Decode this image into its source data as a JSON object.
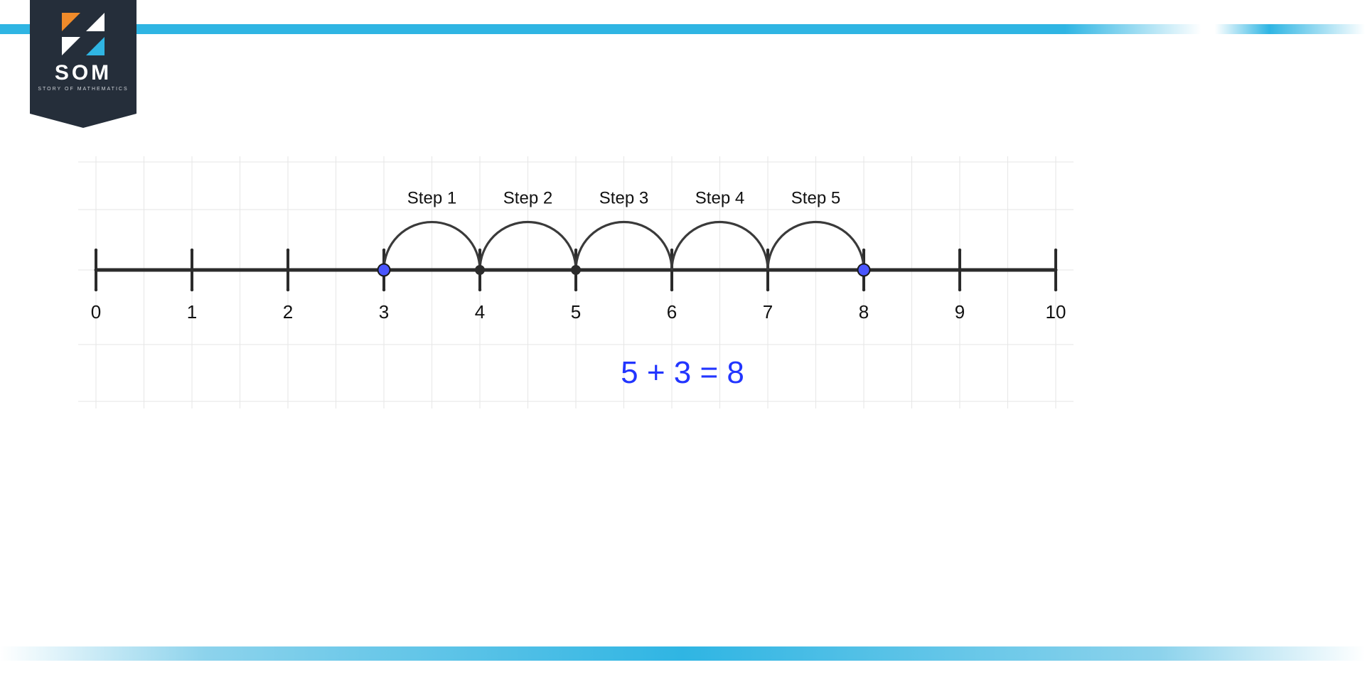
{
  "brand": {
    "short": "SOM",
    "tagline": "STORY OF MATHEMATICS"
  },
  "diagram": {
    "equation": "5 + 3 = 8",
    "start": 3,
    "end": 8,
    "ticks": [
      "0",
      "1",
      "2",
      "3",
      "4",
      "5",
      "6",
      "7",
      "8",
      "9",
      "10"
    ],
    "dark_dots": [
      3,
      4,
      5
    ],
    "blue_dots": [
      3,
      8
    ],
    "arcs": [
      {
        "from": 3,
        "to": 4,
        "label": "Step 1"
      },
      {
        "from": 4,
        "to": 5,
        "label": "Step 2"
      },
      {
        "from": 5,
        "to": 6,
        "label": "Step 3"
      },
      {
        "from": 6,
        "to": 7,
        "label": "Step 4"
      },
      {
        "from": 7,
        "to": 8,
        "label": "Step 5"
      }
    ]
  },
  "colors": {
    "accent_blue": "#2fb5e3",
    "equation_blue": "#2235ff",
    "axis": "#2b2b2b",
    "dot_blue": "#4a56ff",
    "grid": "#e6e6e6"
  }
}
